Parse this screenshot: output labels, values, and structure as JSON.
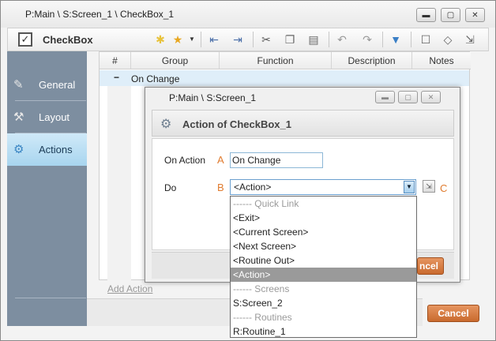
{
  "window": {
    "title": "P:Main \\ S:Screen_1 \\ CheckBox_1",
    "min_glyph": "▬",
    "max_glyph": "▢",
    "close_glyph": "✕"
  },
  "toolbar": {
    "title": "CheckBox",
    "checkbox_glyph": "✓"
  },
  "sidebar": {
    "items": [
      {
        "label": "General",
        "icon": "pencil-icon"
      },
      {
        "label": "Layout",
        "icon": "tools-icon"
      },
      {
        "label": "Actions",
        "icon": "gears-icon"
      }
    ]
  },
  "grid": {
    "columns": [
      "#",
      "Group",
      "Function",
      "Description",
      "Notes"
    ],
    "group_row": {
      "toggle": "−",
      "label": "On Change"
    },
    "add_action": "Add Action"
  },
  "footer": {
    "cancel_label": "Cancel"
  },
  "dialog": {
    "title": "P:Main \\ S:Screen_1",
    "header": "Action of CheckBox_1",
    "on_action_label": "On Action",
    "on_action_value": "On Change",
    "do_label": "Do",
    "do_value": "<Action>",
    "letter_a": "A",
    "letter_b": "B",
    "letter_c": "C",
    "cancel_partial": "ncel"
  },
  "dropdown": {
    "items": [
      {
        "text": "------ Quick Link",
        "header": true
      },
      {
        "text": "<Exit>"
      },
      {
        "text": "<Current Screen>"
      },
      {
        "text": "<Next Screen>"
      },
      {
        "text": "<Routine Out>"
      },
      {
        "text": "<Action>",
        "selected": true
      },
      {
        "text": "------ Screens",
        "header": true
      },
      {
        "text": "S:Screen_2"
      },
      {
        "text": "------ Routines",
        "header": true
      },
      {
        "text": "R:Routine_1"
      }
    ]
  },
  "colors": {
    "accent_orange": "#d2763a",
    "sidebar": "#7d8ea0",
    "active_tab": "#b6dcf2",
    "selected_item": "#9a9a9a"
  }
}
